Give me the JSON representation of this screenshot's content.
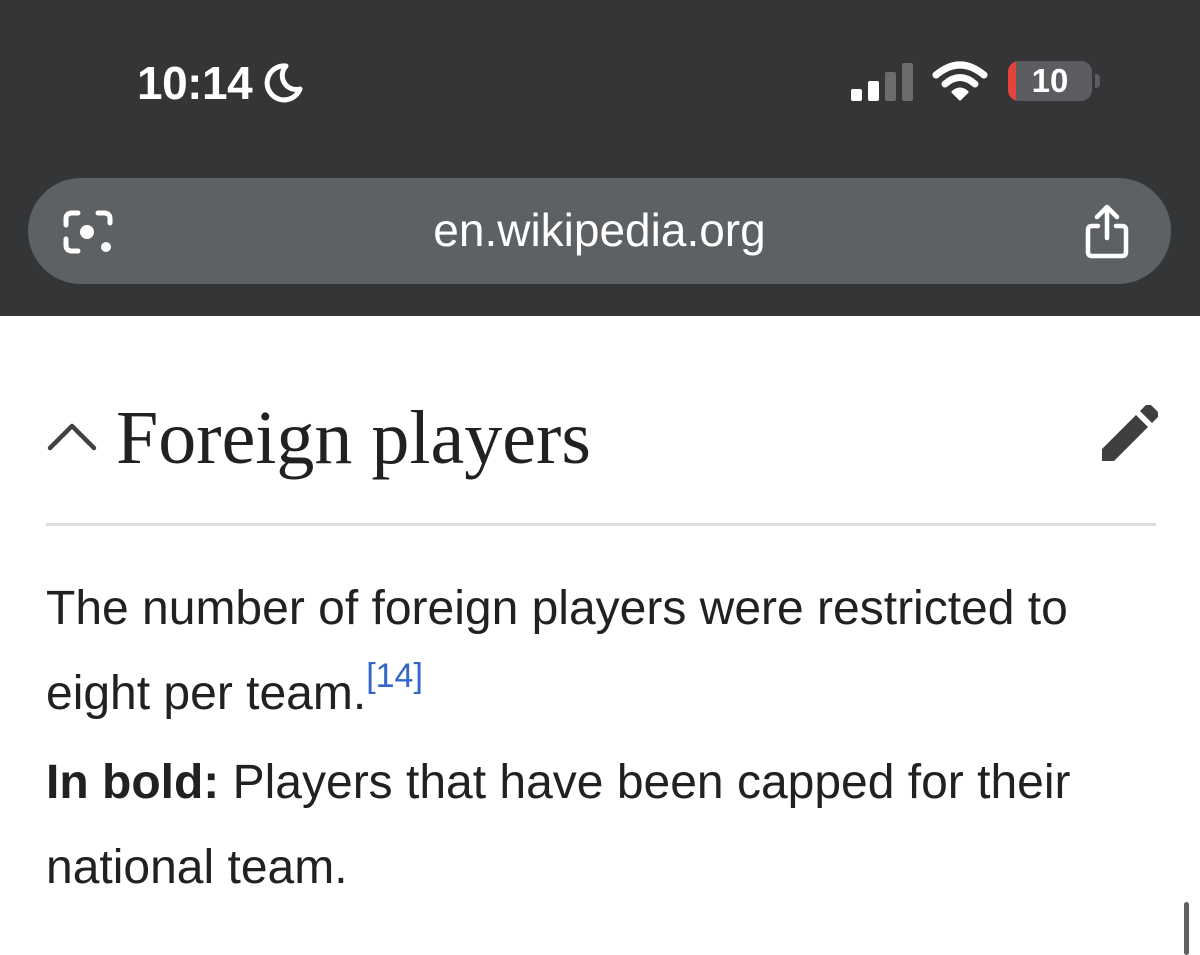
{
  "status_bar": {
    "time": "10:14",
    "battery_level": "10",
    "battery_fraction": 0.1,
    "icons": [
      "moon-icon",
      "signal-icon",
      "wifi-icon",
      "battery-icon"
    ]
  },
  "browser": {
    "url": "en.wikipedia.org",
    "icons": [
      "lens-icon",
      "share-icon"
    ]
  },
  "section": {
    "title": "Foreign players",
    "icons": [
      "chevron-up-icon",
      "pencil-icon"
    ]
  },
  "content": {
    "p1_text": "The number of foreign players were restricted to eight per team.",
    "p1_ref": "[14]",
    "p2_bold": "In bold:",
    "p2_text": " Players that have been capped for their national team."
  },
  "colors": {
    "chrome_background": "#343537",
    "url_bar": "#5d6164",
    "battery_low": "#e5443d",
    "link": "#3366cc",
    "text": "#202122"
  }
}
